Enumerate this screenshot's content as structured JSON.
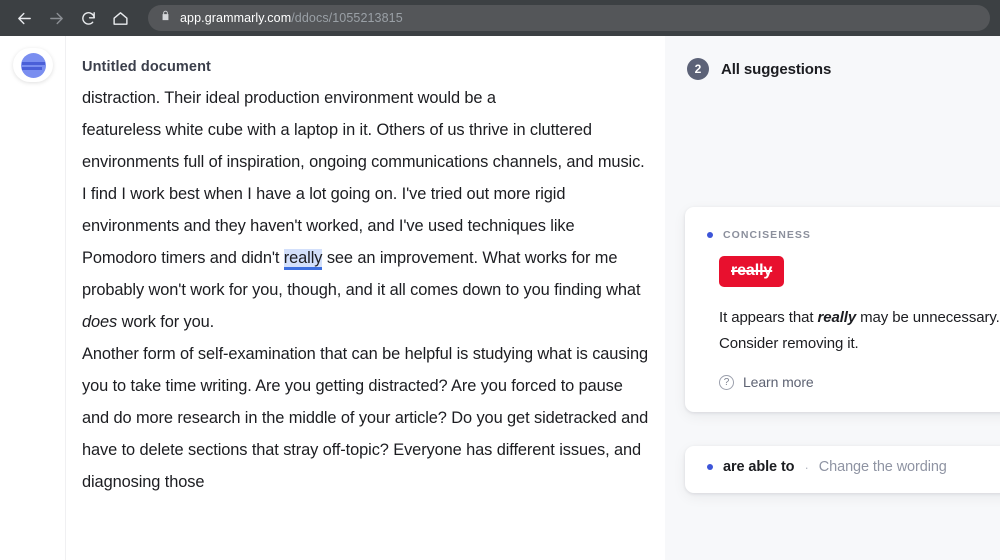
{
  "browser": {
    "back_icon": "arrow-left-icon",
    "forward_icon": "arrow-right-icon",
    "reload_icon": "reload-icon",
    "home_icon": "home-icon",
    "lock_icon": "lock-icon",
    "url_host": "app.grammarly.com",
    "url_path": "/ddocs/1055213815"
  },
  "rail": {
    "logo_name": "grammarly-logo"
  },
  "document": {
    "title": "Untitled document",
    "faded_line": "distraction. Their ideal production environment would be a",
    "para1_a": "featureless white cube with a laptop in it. Others of us thrive in cluttered environments full of inspiration, ongoing communications channels, and music.",
    "para2_a": "I find I work best when I have a lot going on. I've tried out more rigid environments and they haven't worked, and I've used techniques like Pomodoro timers and didn't ",
    "para2_hl": "really",
    "para2_b": " see an improvement. What works for me probably won't work for you, though, and it all comes down to you finding what ",
    "para2_ital": "does",
    "para2_c": " work for you.",
    "para3_a": "Another form of self-examination that can be helpful is studying what is causing you to take time writing. Are you getting distracted? Are you forced to pause and do more research in the middle of your article? Do you get sidetracked and have to delete sections that stray off-topic? Everyone has different issues, and diagnosing those"
  },
  "sidebar": {
    "count": "2",
    "title": "All suggestions",
    "cards": [
      {
        "category": "CONCISENESS",
        "chip": "really",
        "explain_a": "It appears that ",
        "explain_bold": "really",
        "explain_b": " may be unnecessary. Consider removing it.",
        "learn_more": "Learn more",
        "help_icon": "question-mark-icon"
      },
      {
        "word": "are able to",
        "separator": "·",
        "action": "Change the wording"
      }
    ]
  },
  "colors": {
    "chrome_bg": "#3c4043",
    "urlbar_bg": "#545659",
    "accent_blue": "#3d55d8",
    "highlight_blue": "#d3e0fb",
    "chip_red": "#e8102e",
    "panel_bg": "#f7f8fa",
    "badge_gray": "#5c6277"
  }
}
